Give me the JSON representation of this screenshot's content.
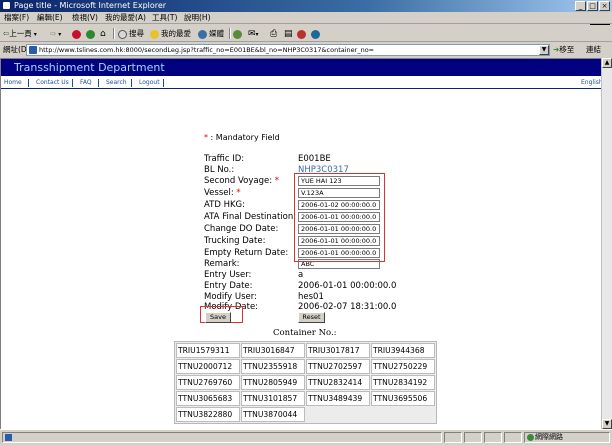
{
  "window": {
    "title": "Page title - Microsoft Internet Explorer",
    "controls": [
      "_",
      "□",
      "×"
    ]
  },
  "menu": [
    "檔案(F)",
    "編輯(E)",
    "檢視(V)",
    "我的最愛(A)",
    "工具(T)",
    "說明(H)"
  ],
  "toolbar": {
    "back": "上一頁",
    "search": "搜尋",
    "favorites": "我的最愛",
    "media": "媒體"
  },
  "address": {
    "label": "網址(D)",
    "url": "http://www.tslines.com.hk:8000/secondLeg.jsp?traffic_no=E001BE&bl_no=NHP3C0317&container_no=",
    "go_label": "移至",
    "links_label": "連結"
  },
  "page": {
    "banner": "Transshipment Department",
    "nav": [
      "Home",
      "Contact Us",
      "FAQ",
      "Search",
      "Logout"
    ],
    "lang": "English",
    "mandatory_star": "*",
    "mandatory_text": ": Mandatory Field",
    "fields": {
      "traffic_id": {
        "label": "Traffic ID:",
        "value": "E001BE"
      },
      "bl_no": {
        "label": "BL No.:",
        "value": "NHP3C0317"
      },
      "second_voyage": {
        "label": "Second Voyage:",
        "value": "YUE HAI 123"
      },
      "vessel": {
        "label": "Vessel:",
        "value": "V.123A"
      },
      "atd_hkg": {
        "label": "ATD HKG:",
        "value": "2006-01-02 00:00:00.0"
      },
      "ata_final": {
        "label": "ATA Final Destination:",
        "value": "2006-01-01 00:00:00.0"
      },
      "change_do": {
        "label": "Change DO Date:",
        "value": "2006-01-01 00:00:00.0"
      },
      "trucking": {
        "label": "Trucking Date:",
        "value": "2006-01-01 00:00:00.0"
      },
      "empty_return": {
        "label": "Empty Return Date:",
        "value": "2006-01-01 00:00:00.0"
      },
      "remark": {
        "label": "Remark:",
        "value": "ABC"
      },
      "entry_user": {
        "label": "Entry User:",
        "value": "a"
      },
      "entry_date": {
        "label": "Entry Date:",
        "value": "2006-01-01 00:00:00.0"
      },
      "modify_user": {
        "label": "Modify User:",
        "value": "hes01"
      },
      "modify_date": {
        "label": "Modify Date:",
        "value": "2006-02-07 18:31:00.0"
      }
    },
    "buttons": {
      "save": "Save",
      "reset": "Reset"
    },
    "container_title": "Container No.:",
    "containers": [
      [
        "TRIU1579311",
        "TRIU3016847",
        "TRIU3017817",
        "TRIU3944368"
      ],
      [
        "TTNU2000712",
        "TTNU2355918",
        "TTNU2702597",
        "TTNU2750229"
      ],
      [
        "TTNU2769760",
        "TTNU2805949",
        "TTNU2832414",
        "TTNU2834192"
      ],
      [
        "TTNU3065683",
        "TTNU3101857",
        "TTNU3489439",
        "TTNU3695506"
      ],
      [
        "TTNU3822880",
        "TTNU3870044",
        "",
        ""
      ]
    ]
  },
  "status": {
    "zone": "網際網路"
  }
}
